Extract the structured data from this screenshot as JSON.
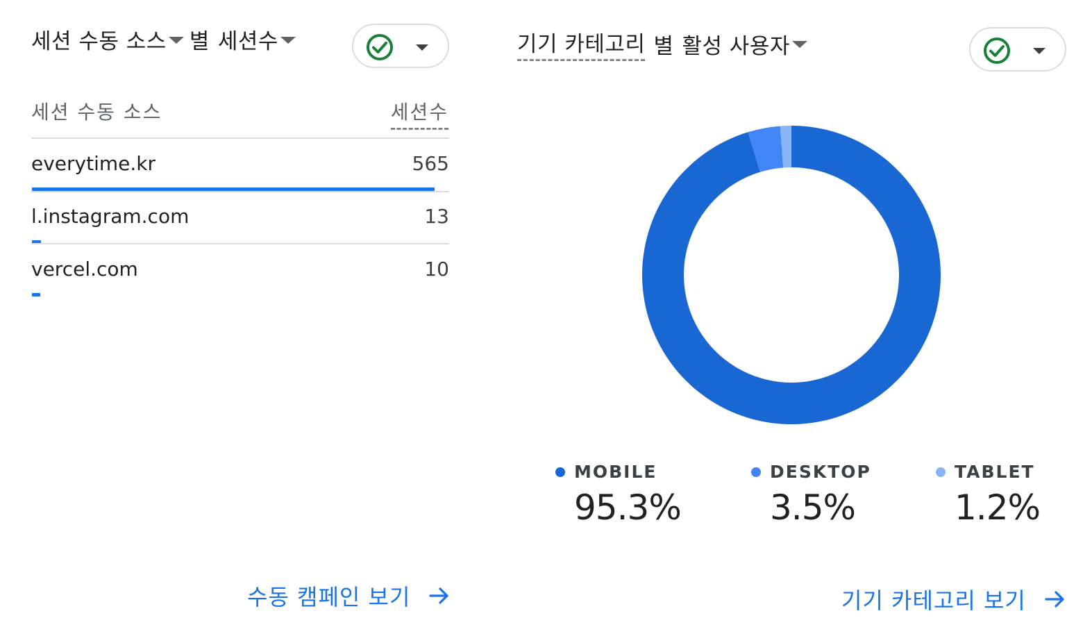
{
  "left_card": {
    "title_part1": "세션 수동 소스",
    "title_part2": "별",
    "title_part3": "세션수",
    "column_source": "세션 수동 소스",
    "column_sessions": "세션수",
    "rows": [
      {
        "source": "everytime.kr",
        "sessions": "565",
        "share": 1.0
      },
      {
        "source": "l.instagram.com",
        "sessions": "13",
        "share": 0.023
      },
      {
        "source": "vercel.com",
        "sessions": "10",
        "share": 0.018
      }
    ],
    "link_label": "수동 캠페인 보기"
  },
  "right_card": {
    "title_part1": "기기 카테고리",
    "title_part2": "별",
    "title_part3": "활성 사용자",
    "legend": [
      {
        "label": "MOBILE",
        "value": "95.3%",
        "color": "#1967d2"
      },
      {
        "label": "DESKTOP",
        "value": "3.5%",
        "color": "#4285f4"
      },
      {
        "label": "TABLET",
        "value": "1.2%",
        "color": "#8ab4f8"
      }
    ],
    "link_label": "기기 카테고리 보기"
  },
  "chart_data": {
    "type": "pie",
    "categories": [
      "MOBILE",
      "DESKTOP",
      "TABLET"
    ],
    "values": [
      95.3,
      3.5,
      1.2
    ],
    "colors": [
      "#1967d2",
      "#4285f4",
      "#8ab4f8"
    ],
    "donut": true,
    "legend": "bottom"
  },
  "colors": {
    "accent": "#1a73e8",
    "check_green": "#188038"
  },
  "icons": {
    "status": "check-circle-icon",
    "link_arrow": "arrow-right-icon"
  }
}
